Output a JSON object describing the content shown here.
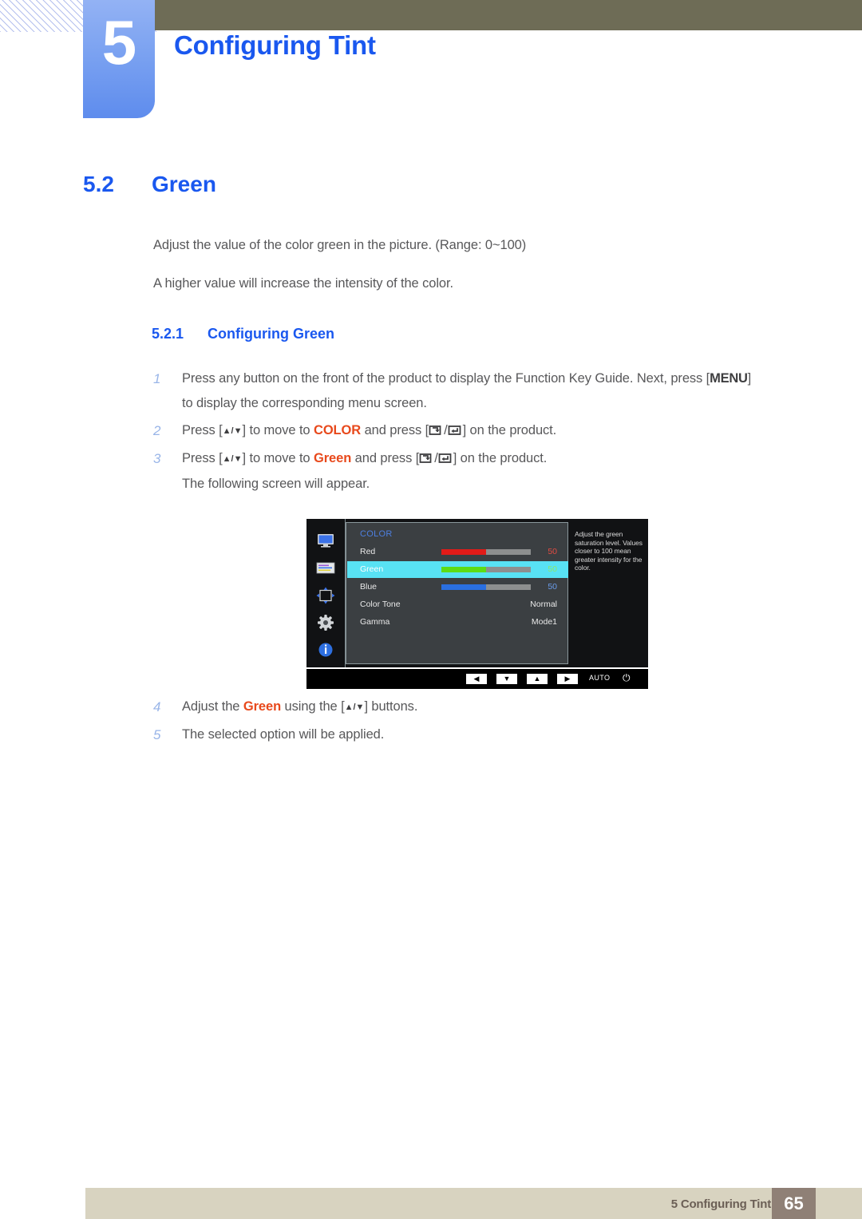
{
  "chapter": {
    "number": "5",
    "title": "Configuring Tint"
  },
  "section": {
    "number": "5.2",
    "title": "Green"
  },
  "intro": {
    "line1": "Adjust the value of the color green in the picture. (Range: 0~100)",
    "line2": "A higher value will increase the intensity of the color."
  },
  "subsection": {
    "number": "5.2.1",
    "title": "Configuring Green"
  },
  "steps": [
    {
      "n": "1",
      "text_a": "Press any button on the front of the product to display the Function Key Guide. Next, press [",
      "kbd": "MENU",
      "text_b": "]",
      "line2": "to display the corresponding menu screen."
    },
    {
      "n": "2",
      "text_a": "Press [",
      "arrows": "▲/▼",
      "text_b": "] to move to ",
      "highlight": "COLOR",
      "text_c": " and press [",
      "text_d": "/",
      "text_e": "] on the product."
    },
    {
      "n": "3",
      "text_a": "Press [",
      "arrows": "▲/▼",
      "text_b": "] to move to ",
      "highlight": "Green",
      "text_c": " and press [",
      "text_d": "/",
      "text_e": "] on the product.",
      "line2": "The following screen will appear."
    },
    {
      "n": "4",
      "text_a": "Adjust the ",
      "highlight": "Green",
      "text_b": " using the [",
      "arrows": "▲/▼",
      "text_c": "] buttons."
    },
    {
      "n": "5",
      "text_a": "The selected option will be applied."
    }
  ],
  "osd": {
    "title": "COLOR",
    "icons": [
      "monitor-icon",
      "picture-settings-icon",
      "screen-adjust-icon",
      "gear-icon",
      "info-icon"
    ],
    "rows": [
      {
        "label": "Red",
        "value": "50",
        "type": "slider",
        "fill": "#e21b18",
        "value_color": "#e24b42",
        "selected": false
      },
      {
        "label": "Green",
        "value": "50",
        "type": "slider",
        "fill": "#5ddc14",
        "value_color": "#8be86a",
        "selected": true
      },
      {
        "label": "Blue",
        "value": "50",
        "type": "slider",
        "fill": "#2a6fe0",
        "value_color": "#6a9ceb",
        "selected": false
      },
      {
        "label": "Color Tone",
        "value": "Normal",
        "type": "text",
        "selected": false
      },
      {
        "label": "Gamma",
        "value": "Mode1",
        "type": "text",
        "selected": false
      }
    ],
    "help_text": "Adjust the green saturation level. Values closer to 100 mean greater intensity for the color.",
    "bottom_buttons": [
      "◀",
      "▼",
      "▲",
      "▶"
    ],
    "auto_label": "AUTO",
    "power_icon": "⏻"
  },
  "footer": {
    "text": "5 Configuring Tint",
    "page": "65"
  },
  "colors": {
    "accent_blue": "#1a58ef",
    "tab_blue": "#7ba2f1",
    "header_olive": "#6e6c56",
    "highlight_red": "#e8491c",
    "footer_bar": "#d8d3c0",
    "footer_page": "#8f8076",
    "osd_selected": "#58e2f4"
  }
}
